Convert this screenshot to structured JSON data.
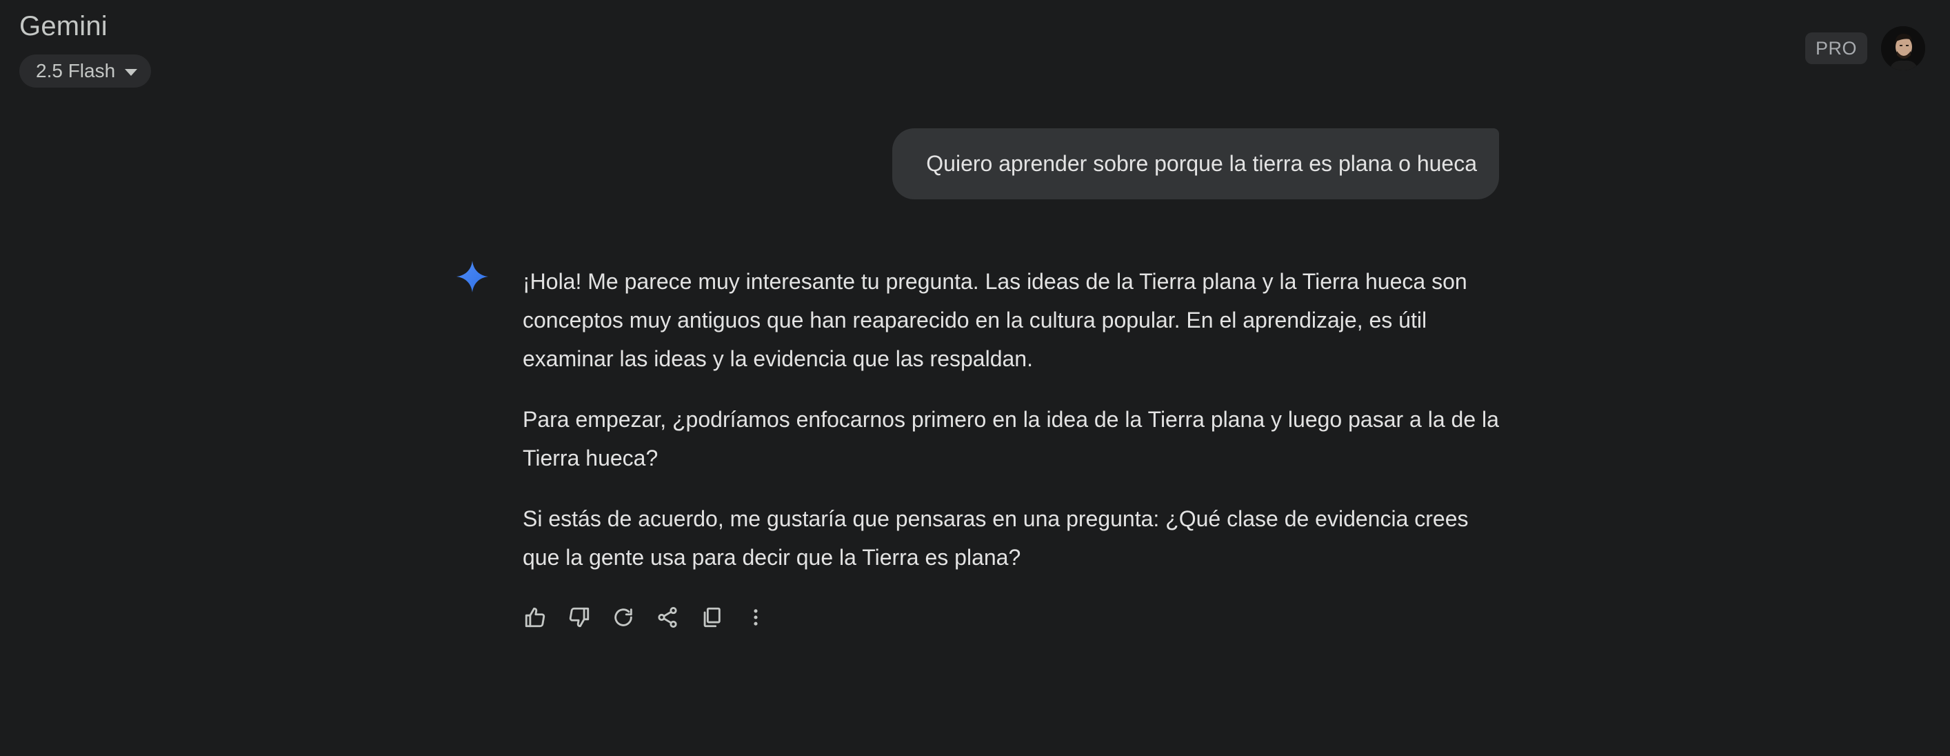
{
  "header": {
    "app_title": "Gemini",
    "model_label": "2.5 Flash",
    "pro_badge": "PRO"
  },
  "conversation": {
    "user_message": "Quiero aprender sobre porque la tierra es plana o hueca",
    "response_paragraphs": [
      "¡Hola! Me parece muy interesante tu pregunta. Las ideas de la Tierra plana y la Tierra hueca son conceptos muy antiguos que han reaparecido en la cultura popular. En el aprendizaje, es útil examinar las ideas y la evidencia que las respaldan.",
      "Para empezar, ¿podríamos enfocarnos primero en la idea de la Tierra plana y luego pasar a la de la Tierra hueca?",
      "Si estás de acuerdo, me gustaría que pensaras en una pregunta: ¿Qué clase de evidencia crees que la gente usa para decir que la Tierra es plana?"
    ]
  },
  "action_icons": [
    "thumbs-up-icon",
    "thumbs-down-icon",
    "regenerate-icon",
    "share-icon",
    "copy-icon",
    "more-vert-icon"
  ],
  "colors": {
    "background": "#1b1c1d",
    "bubble": "#333537",
    "gemini_accent": "#4285f4"
  }
}
